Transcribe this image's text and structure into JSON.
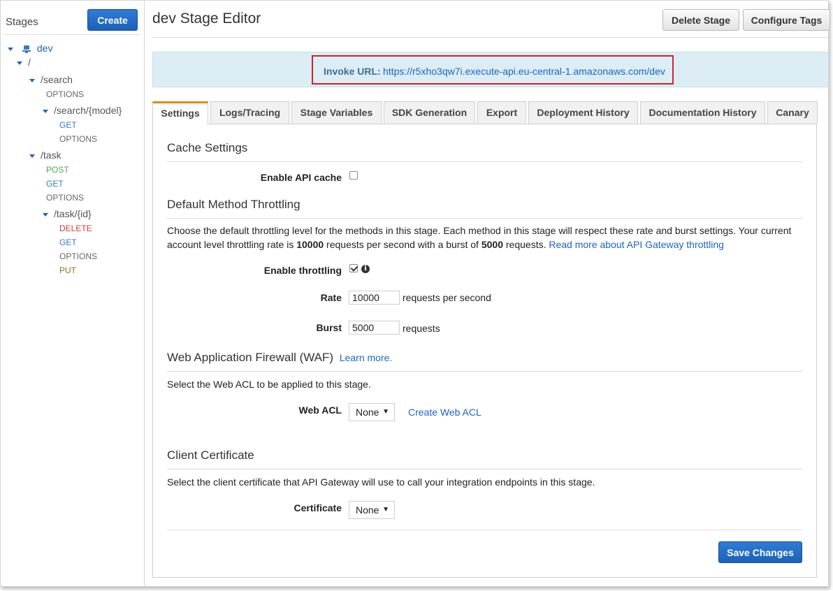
{
  "sidebar": {
    "title": "Stages",
    "create_label": "Create",
    "stage": "dev",
    "root": "/",
    "search": "/search",
    "search_options": "OPTIONS",
    "search_model": "/search/{model}",
    "search_model_get": "GET",
    "search_model_options": "OPTIONS",
    "task": "/task",
    "task_post": "POST",
    "task_get": "GET",
    "task_options": "OPTIONS",
    "task_id": "/task/{id}",
    "task_id_delete": "DELETE",
    "task_id_get": "GET",
    "task_id_options": "OPTIONS",
    "task_id_put": "PUT"
  },
  "header": {
    "title": "dev Stage Editor",
    "delete_label": "Delete Stage",
    "tags_label": "Configure Tags"
  },
  "invoke": {
    "label": "Invoke URL:",
    "url": "https://r5xho3qw7i.execute-api.eu-central-1.amazonaws.com/dev"
  },
  "tabs": {
    "settings": "Settings",
    "logs": "Logs/Tracing",
    "variables": "Stage Variables",
    "sdk": "SDK Generation",
    "export": "Export",
    "deploy_history": "Deployment History",
    "doc_history": "Documentation History",
    "canary": "Canary"
  },
  "cache": {
    "title": "Cache Settings",
    "enable_label": "Enable API cache",
    "enabled": false
  },
  "throttling": {
    "title": "Default Method Throttling",
    "desc_a": "Choose the default throttling level for the methods in this stage. Each method in this stage will respect these rate and burst settings. Your current account level throttling rate is ",
    "rate_bold": "10000",
    "desc_b": " requests per second with a burst of ",
    "burst_bold": "5000",
    "desc_c": " requests. ",
    "read_more": "Read more about API Gateway throttling",
    "enable_label": "Enable throttling",
    "enabled": true,
    "rate_label": "Rate",
    "rate_value": "10000",
    "rate_unit": "requests per second",
    "burst_label": "Burst",
    "burst_value": "5000",
    "burst_unit": "requests"
  },
  "waf": {
    "title": "Web Application Firewall (WAF)",
    "learn_more": "Learn more.",
    "desc": "Select the Web ACL to be applied to this stage.",
    "acl_label": "Web ACL",
    "acl_value": "None",
    "create_link": "Create Web ACL"
  },
  "cert": {
    "title": "Client Certificate",
    "desc": "Select the client certificate that API Gateway will use to call your integration endpoints in this stage.",
    "label": "Certificate",
    "value": "None"
  },
  "footer": {
    "save_label": "Save Changes"
  },
  "icons": {
    "stage": "stage-icon",
    "info": "info-icon",
    "caret": "caret-down-icon"
  },
  "colors": {
    "primary": "#1b62b8",
    "link": "#1a65c7",
    "active_tab": "#e8861c",
    "invoke_bg": "#dcedf5",
    "highlight": "#d0232a"
  }
}
